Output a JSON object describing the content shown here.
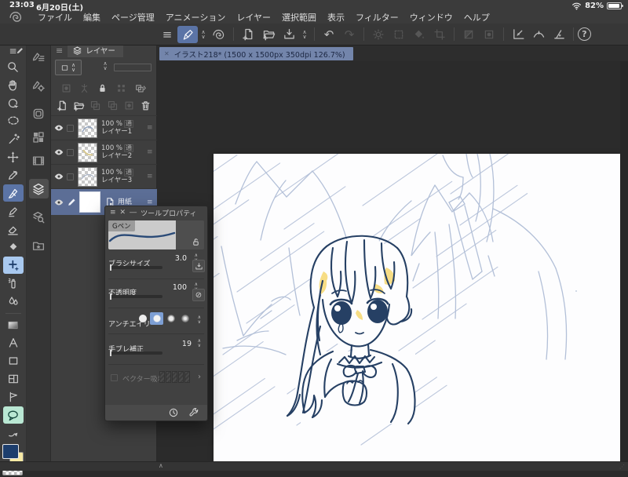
{
  "status_bar": {
    "time": "23:03",
    "date": "6月20日(土)",
    "battery_percent": "82%"
  },
  "menu_bar": {
    "items": [
      "ファイル",
      "編集",
      "ページ管理",
      "アニメーション",
      "レイヤー",
      "選択範囲",
      "表示",
      "フィルター",
      "ウィンドウ",
      "ヘルプ"
    ]
  },
  "document_tab": {
    "title": "イラスト218* (1500 x 1500px 350dpi 126.7%)"
  },
  "layers_panel": {
    "title": "レイヤー",
    "layers": [
      {
        "opacity": "100 %",
        "blend_badge": "通",
        "name": "レイヤー1"
      },
      {
        "opacity": "100 %",
        "blend_badge": "通",
        "name": "レイヤー2"
      },
      {
        "opacity": "100 %",
        "blend_badge": "通",
        "name": "レイヤー3"
      },
      {
        "name": "用紙"
      }
    ]
  },
  "tool_property": {
    "title": "ツールプロパティ",
    "tool_name": "Gペン",
    "brush_size": {
      "label": "ブラシサイズ",
      "value": "3.0"
    },
    "opacity": {
      "label": "不透明度",
      "value": "100"
    },
    "anti_aliasing": {
      "label": "アンチエイリ"
    },
    "stabilization": {
      "label": "手ブレ補正",
      "value": "19"
    },
    "vector_snap": {
      "label": "ベクター吸着"
    }
  },
  "icons": {
    "menu": "≡",
    "grip": "≡",
    "chevron_up": "∧",
    "chevron_down": "∨",
    "undo": "↶",
    "redo": "↷",
    "close": "✕",
    "minimize": "―",
    "help": "?",
    "none": "⊘",
    "arrow_right": "›",
    "ellipsis_grip": "⋰"
  },
  "canvas_status": {
    "expand_chevron": "∧"
  },
  "colors": {
    "accent_selection": "#5b74a6",
    "tab_highlight": "#7385ab",
    "layer_selected": "#5c6e96",
    "tool_plus_highlight": "#a9c9ef",
    "tool_balloon_highlight": "#b9e7d3",
    "sketch_line": "#b3c0d8",
    "ink_line": "#264064",
    "hair_highlight": "#f7dd84"
  },
  "color_swatches": {
    "foreground": "#1d3e6d",
    "background": "#f6e9a4"
  }
}
